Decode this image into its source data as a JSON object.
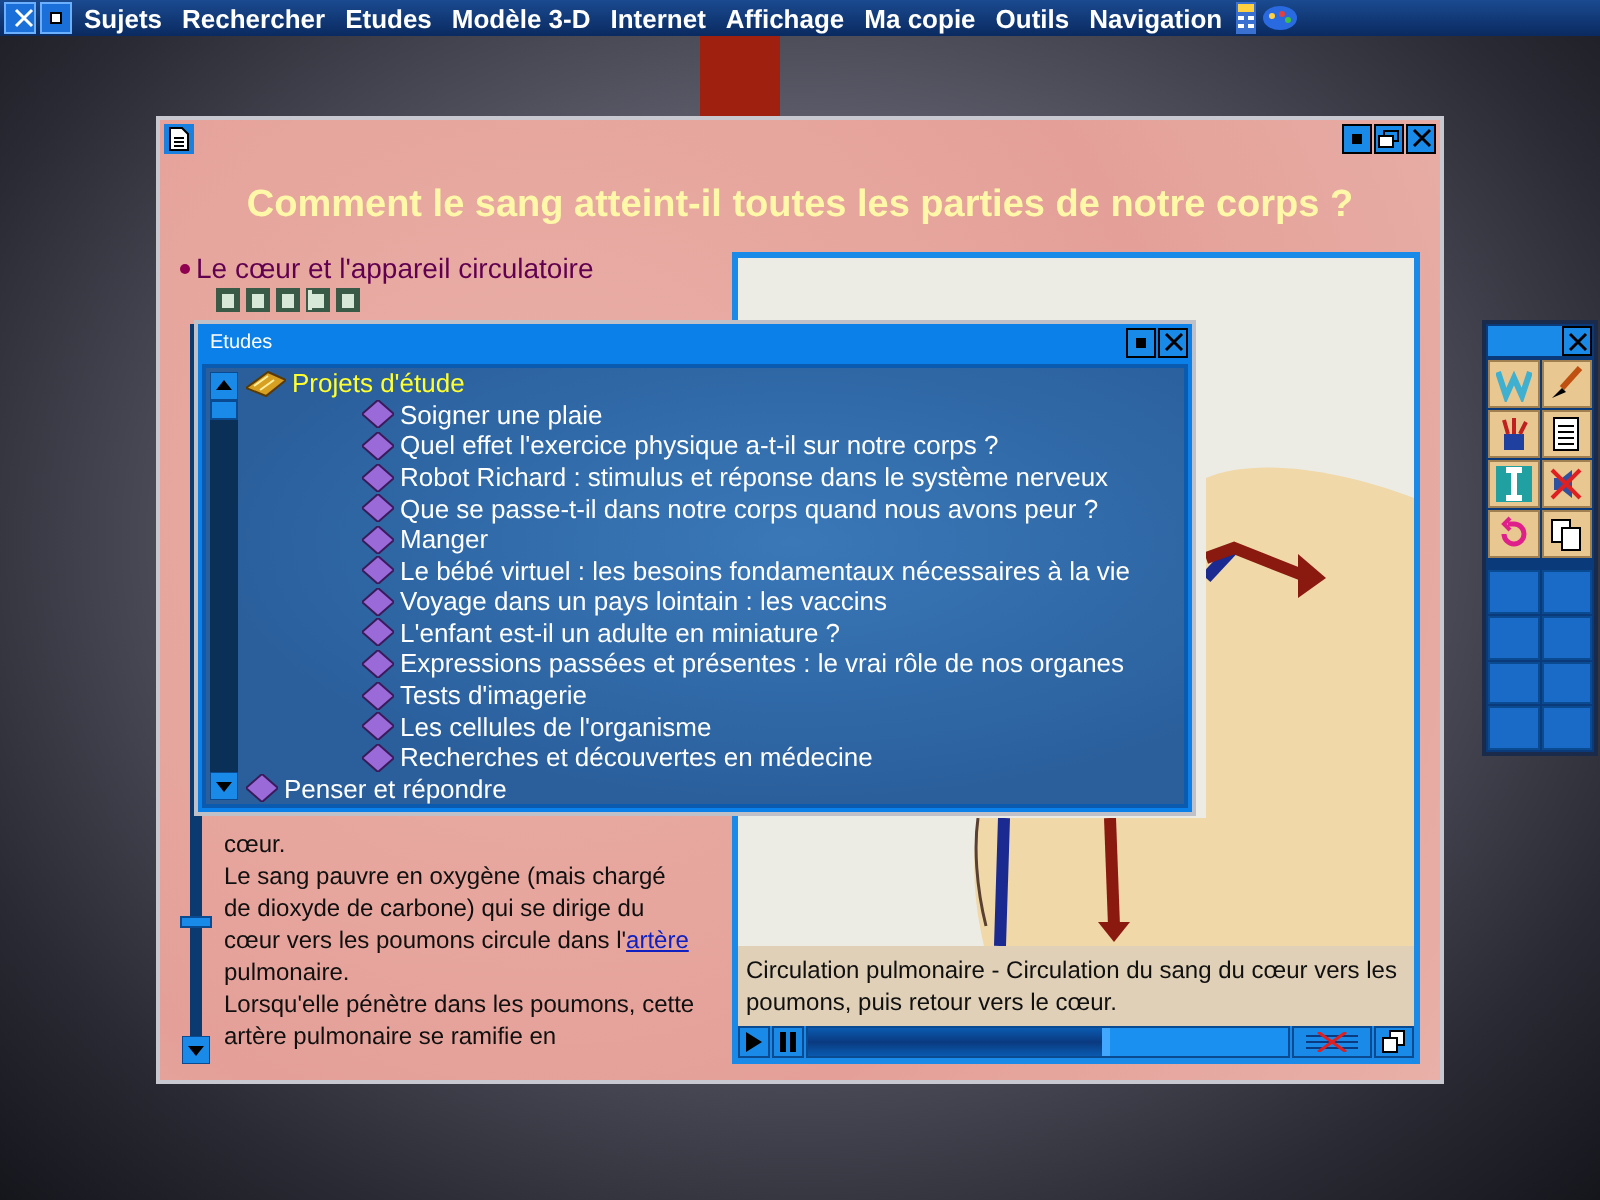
{
  "menu_bar": {
    "items": [
      "Sujets",
      "Rechercher",
      "Etudes",
      "Modèle 3-D",
      "Internet",
      "Affichage",
      "Ma copie",
      "Outils",
      "Navigation"
    ]
  },
  "main_window": {
    "heading": "Comment le sang atteint-il toutes les parties de notre corps ?",
    "topic": "Le cœur et l'appareil circulatoire",
    "body": [
      {
        "parts": [
          {
            "kind": "plain",
            "text": "cœur."
          }
        ]
      },
      {
        "parts": [
          {
            "kind": "plain",
            "text": "Le sang pauvre en oxygène (mais chargé de dioxyde de carbone) qui se dirige du cœur vers les poumons circule dans l'"
          },
          {
            "kind": "link",
            "text": "artère"
          },
          {
            "kind": "plain",
            "text": " pulmonaire."
          }
        ]
      },
      {
        "parts": [
          {
            "kind": "plain",
            "text": "Lorsqu'elle pénètre dans les poumons, cette artère pulmonaire se ramifie en"
          }
        ]
      }
    ],
    "figure": {
      "caption": "Circulation pulmonaire - Circulation du sang du cœur vers les poumons, puis retour vers le cœur.",
      "progress": {
        "level": 0.63
      }
    }
  },
  "etudes_window": {
    "title": "Etudes",
    "tree": [
      {
        "label": "Projets d'étude",
        "expanded": true,
        "children": [
          {
            "label": "Soigner une plaie"
          },
          {
            "label": "Quel effet l'exercice physique a-t-il sur notre corps ?"
          },
          {
            "label": "Robot Richard : stimulus et réponse dans le système nerveux"
          },
          {
            "label": "Que se passe-t-il dans notre corps quand nous avons peur ?"
          },
          {
            "label": "Manger"
          },
          {
            "label": "Le bébé virtuel : les besoins fondamentaux nécessaires à la vie"
          },
          {
            "label": "Voyage dans un pays lointain : les vaccins"
          },
          {
            "label": "L'enfant est-il un adulte en miniature ?"
          },
          {
            "label": "Expressions passées et présentes : le vrai rôle de nos organes"
          },
          {
            "label": "Tests d'imagerie"
          },
          {
            "label": "Les cellules de l'organisme"
          },
          {
            "label": "Recherches et découvertes en médecine"
          }
        ]
      },
      {
        "label": "Penser et répondre",
        "expanded": false
      }
    ]
  }
}
